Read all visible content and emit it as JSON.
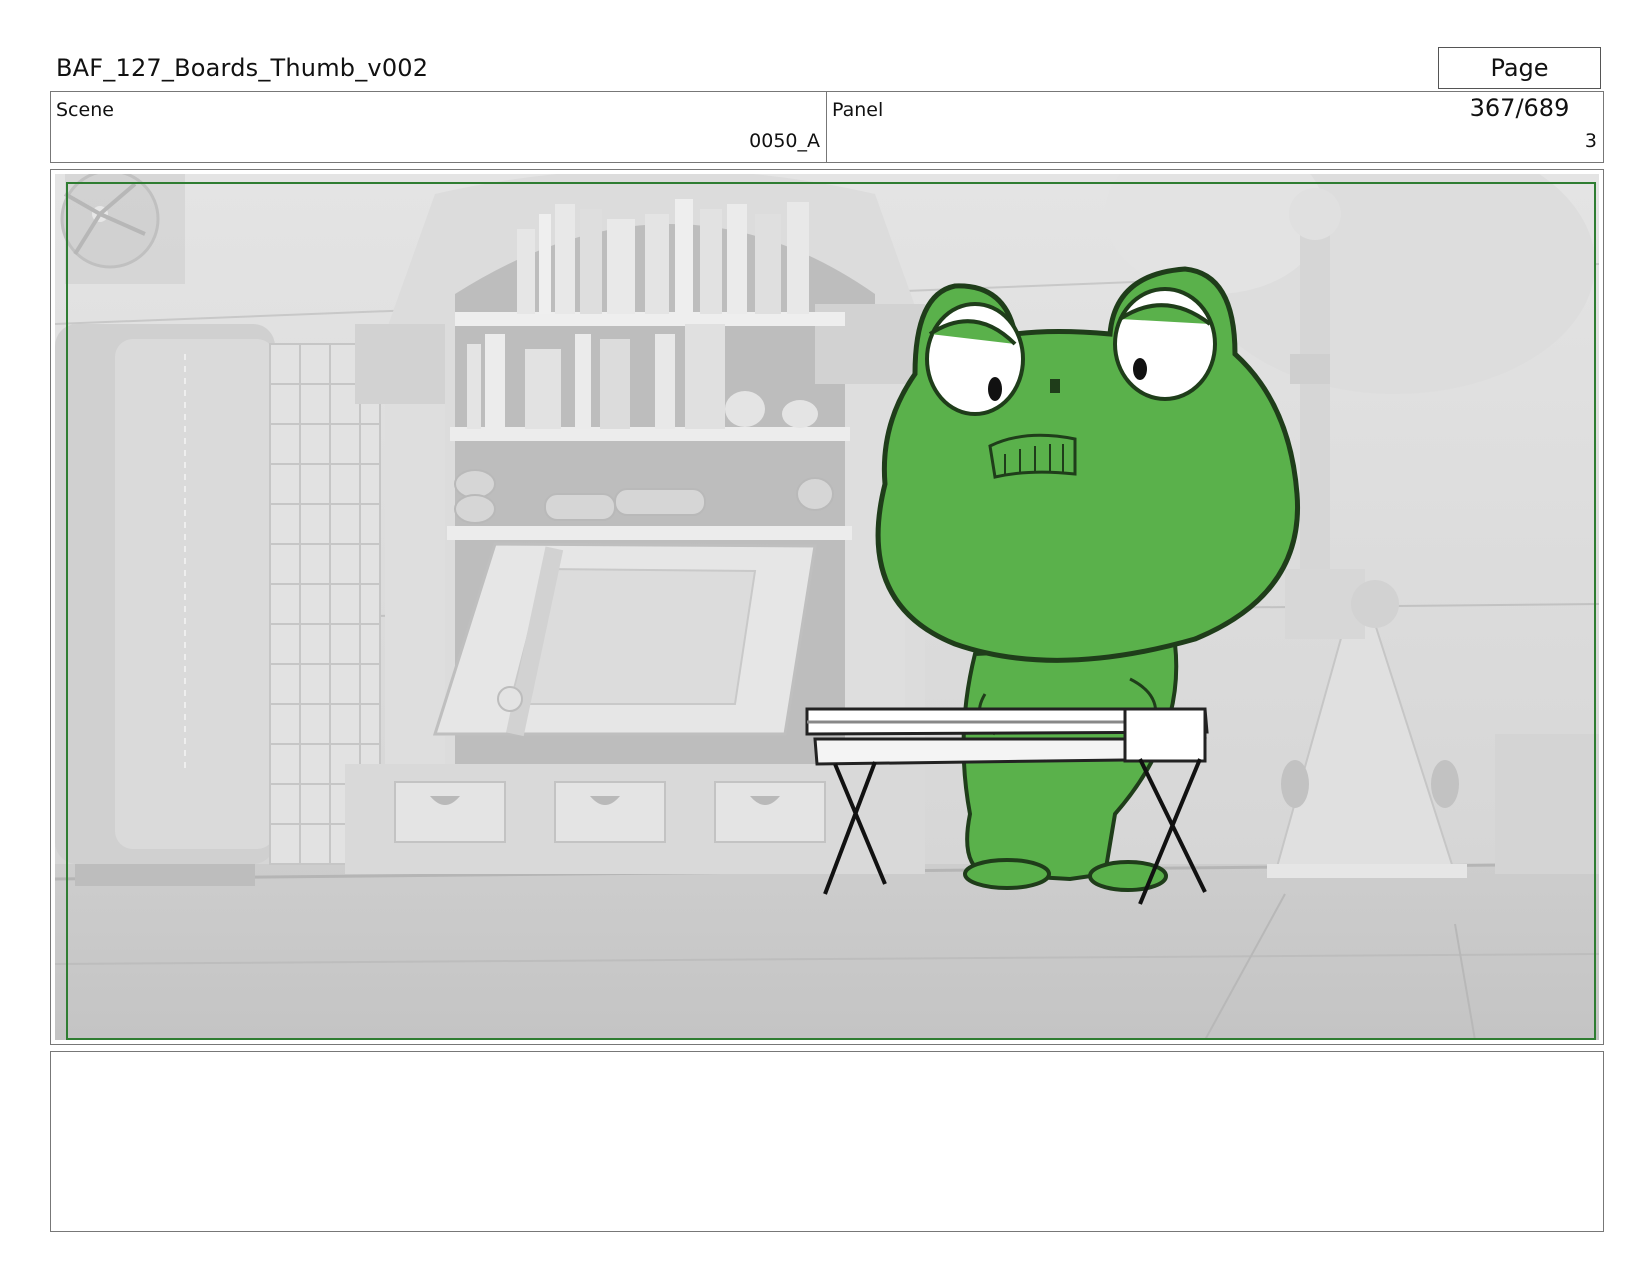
{
  "header": {
    "title": "BAF_127_Boards_Thumb_v002",
    "page": "Page 367/689"
  },
  "info": {
    "scene_label": "Scene",
    "scene_value": "0050_A",
    "panel_label": "Panel",
    "panel_value": "3"
  },
  "frame": {
    "safe_frame_color": "#2f7d32",
    "character_color": "#5ab14b",
    "background_tone": "#d8d8d8"
  },
  "notes": {
    "text": ""
  }
}
